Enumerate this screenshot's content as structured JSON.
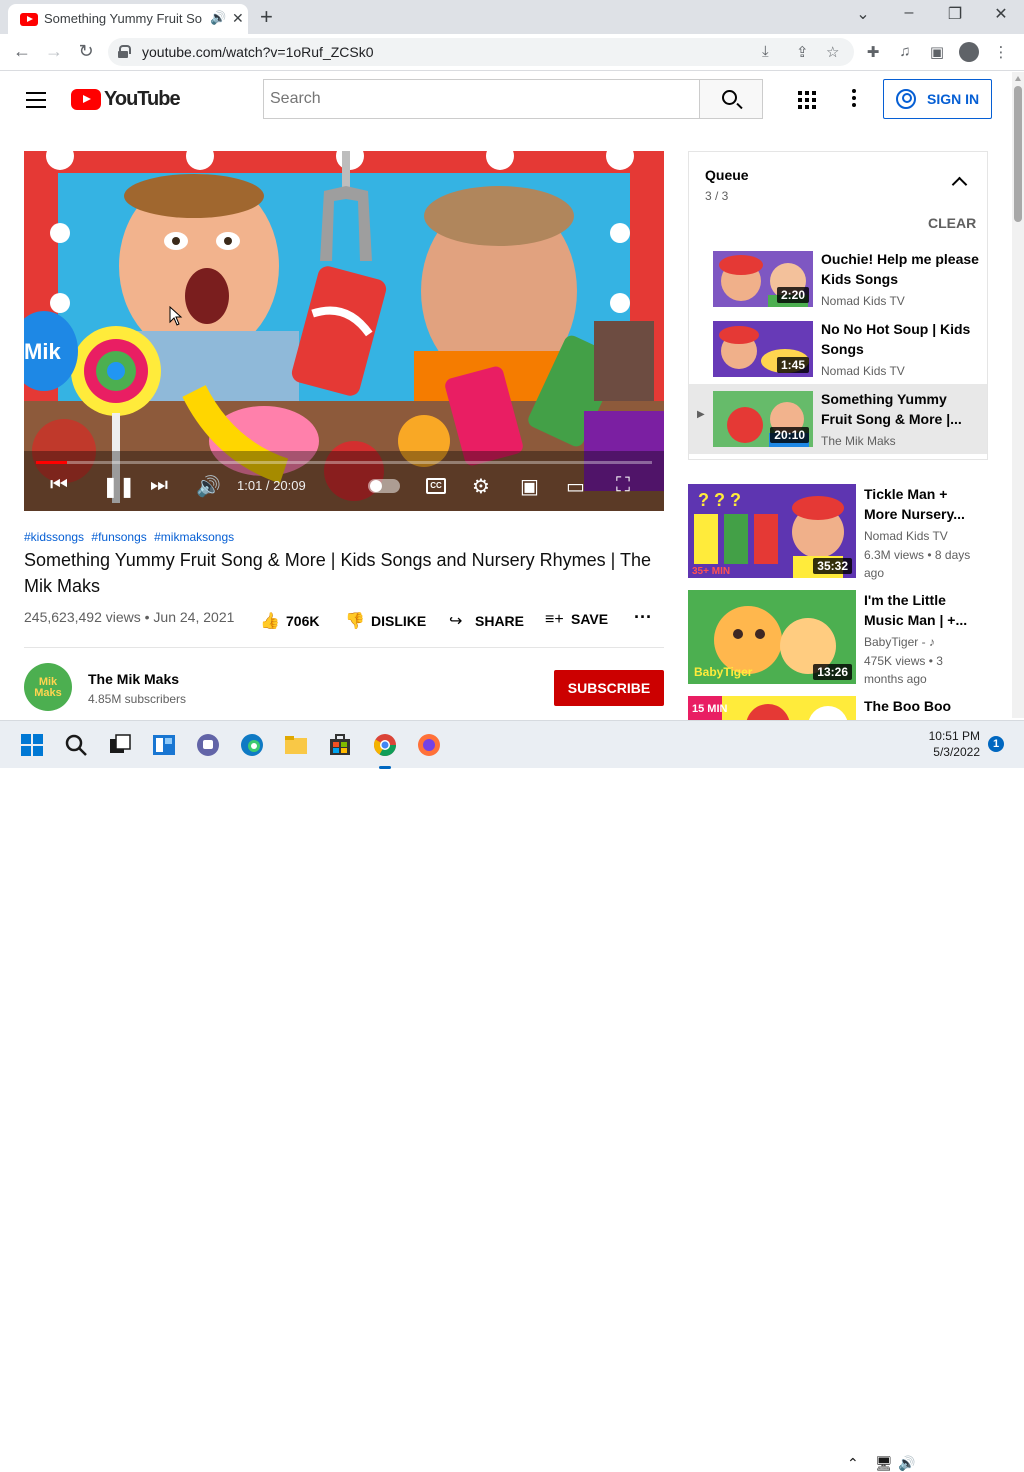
{
  "browser": {
    "tab_title": "Something Yummy Fruit Song",
    "url": "youtube.com/watch?v=1oRuf_ZCSk0",
    "new_tab_icon": "plus-icon",
    "window_controls": [
      "chevron-down-icon",
      "minimize-icon",
      "restore-icon",
      "close-icon"
    ]
  },
  "youtube": {
    "logo_text": "YouTube",
    "search_placeholder": "Search",
    "sign_in_label": "SIGN IN"
  },
  "player": {
    "time": "1:01 / 20:09",
    "progress": 0.05,
    "cc_label": "CC"
  },
  "video": {
    "hashtags": [
      "#kidssongs",
      "#funsongs",
      "#mikmaksongs"
    ],
    "title": "Something Yummy Fruit Song & More | Kids Songs and Nursery Rhymes | The Mik Maks",
    "views_date": "245,623,492 views • Jun 24, 2021",
    "like_count": "706K",
    "dislike_label": "DISLIKE",
    "share_label": "SHARE",
    "save_label": "SAVE",
    "channel_name": "The Mik Maks",
    "channel_avatar_text": "Mik Maks",
    "subscribers": "4.85M subscribers",
    "subscribe_label": "SUBSCRIBE"
  },
  "queue": {
    "title": "Queue",
    "count": "3 / 3",
    "clear_label": "CLEAR",
    "items": [
      {
        "title": "Ouchie! Help me please Kids Songs",
        "channel": "Nomad Kids TV",
        "duration": "2:20"
      },
      {
        "title": "No No Hot Soup | Kids Songs",
        "channel": "Nomad Kids TV",
        "duration": "1:45"
      },
      {
        "title": "Something Yummy Fruit Song & More |...",
        "channel": "The Mik Maks",
        "duration": "20:10"
      }
    ]
  },
  "recommendations": [
    {
      "title": "Tickle Man + More Nursery...",
      "channel": "Nomad Kids TV",
      "meta": "6.3M views • 8 days ago",
      "duration": "35:32"
    },
    {
      "title": "I'm the Little Music Man | +...",
      "channel": "BabyTiger - ♪",
      "meta": "475K views • 3 months ago",
      "duration": "13:26"
    },
    {
      "title": "The Boo Boo",
      "channel": "",
      "meta": "",
      "duration": ""
    }
  ],
  "taskbar": {
    "time": "10:51 PM",
    "date": "5/3/2022",
    "notification_count": "1"
  },
  "colors": {
    "youtube_red": "#ff0000",
    "subscribe_red": "#cc0000",
    "link_blue": "#065fd4",
    "chrome_tab_bg": "#dee1e6"
  }
}
